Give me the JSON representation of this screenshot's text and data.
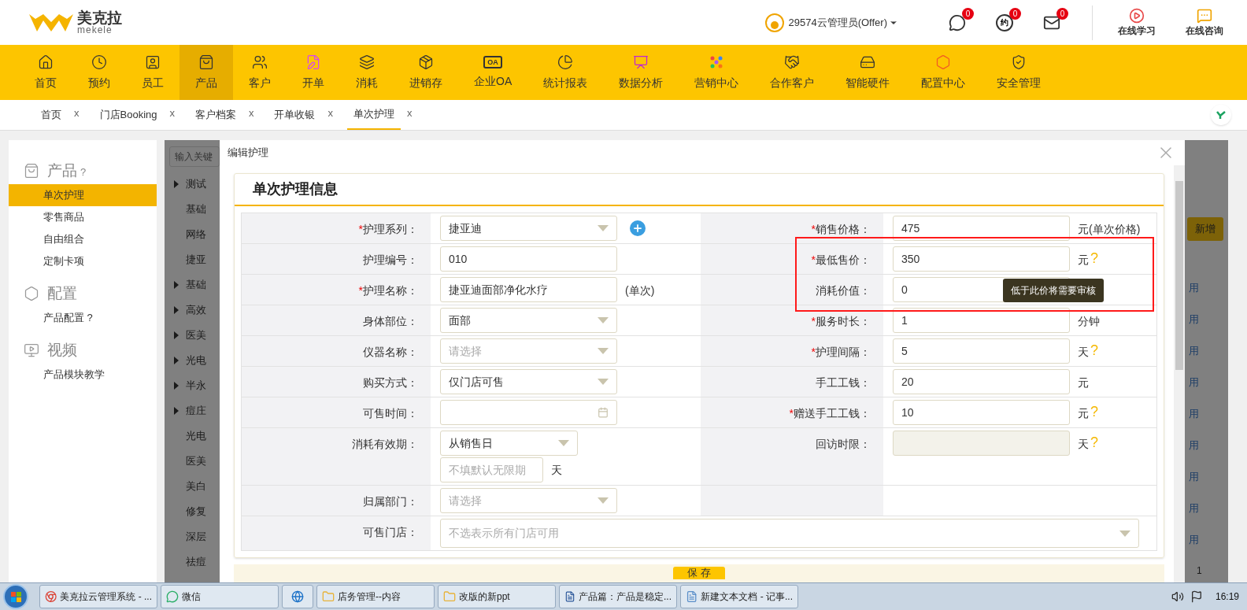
{
  "logo": {
    "name": "美克拉",
    "sub": "mekele"
  },
  "header": {
    "user": "29574云管理员(Offer)",
    "notifications": [
      {
        "badge": "0"
      },
      {
        "badge": "0",
        "glyph": "约"
      },
      {
        "badge": "0"
      }
    ],
    "links": [
      "在线学习",
      "在线咨询"
    ]
  },
  "nav": [
    {
      "label": "首页",
      "selected": false
    },
    {
      "label": "预约",
      "selected": false
    },
    {
      "label": "员工",
      "selected": false
    },
    {
      "label": "产品",
      "selected": true
    },
    {
      "label": "客户",
      "selected": false
    },
    {
      "label": "开单",
      "selected": false
    },
    {
      "label": "消耗",
      "selected": false
    },
    {
      "label": "进销存",
      "selected": false
    },
    {
      "label": "企业OA",
      "selected": false,
      "glyph": "OA"
    },
    {
      "label": "统计报表",
      "selected": false
    },
    {
      "label": "数据分析",
      "selected": false
    },
    {
      "label": "营销中心",
      "selected": false
    },
    {
      "label": "合作客户",
      "selected": false
    },
    {
      "label": "智能硬件",
      "selected": false
    },
    {
      "label": "配置中心",
      "selected": false
    },
    {
      "label": "安全管理",
      "selected": false
    }
  ],
  "tabs": [
    {
      "label": "首页",
      "close": "x",
      "selected": false
    },
    {
      "label": "门店Booking",
      "close": "x",
      "selected": false
    },
    {
      "label": "客户档案",
      "close": "x",
      "selected": false
    },
    {
      "label": "开单收银",
      "close": "x",
      "selected": false
    },
    {
      "label": "单次护理",
      "close": "x",
      "selected": true
    }
  ],
  "sidebar": [
    {
      "title": "产品",
      "help": "?",
      "items": [
        {
          "label": "单次护理",
          "selected": true
        },
        {
          "label": "零售商品",
          "selected": false
        },
        {
          "label": "自由组合",
          "selected": false
        },
        {
          "label": "定制卡项",
          "selected": false
        }
      ]
    },
    {
      "title": "配置",
      "items": [
        {
          "label": "产品配置 ?",
          "selected": false
        }
      ]
    },
    {
      "title": "视频",
      "items": [
        {
          "label": "产品模块教学",
          "selected": false
        }
      ]
    }
  ],
  "background": {
    "search_placeholder": "输入关键",
    "tree": [
      {
        "label": "测试",
        "expandable": true
      },
      {
        "label": "基础",
        "expandable": false
      },
      {
        "label": "网络",
        "expandable": false
      },
      {
        "label": "捷亚",
        "expandable": false
      },
      {
        "label": "基础",
        "expandable": true
      },
      {
        "label": "高效",
        "expandable": true
      },
      {
        "label": "医美",
        "expandable": true
      },
      {
        "label": "光电",
        "expandable": true
      },
      {
        "label": "半永",
        "expandable": true
      },
      {
        "label": "痘庄",
        "expandable": true
      },
      {
        "label": "光电",
        "expandable": false
      },
      {
        "label": "医美",
        "expandable": false
      },
      {
        "label": "美白",
        "expandable": false
      },
      {
        "label": "修复",
        "expandable": false
      },
      {
        "label": "深层",
        "expandable": false
      },
      {
        "label": "祛痘",
        "expandable": false
      }
    ],
    "add_button": "新增",
    "status_cells": [
      "用",
      "用",
      "用",
      "用",
      "用",
      "用",
      "用",
      "用",
      "用"
    ],
    "page": "1"
  },
  "modal": {
    "title": "编辑护理",
    "section": "单次护理信息",
    "save": "保 存",
    "rows": [
      {
        "left": {
          "mark": "*",
          "label": "护理系列：",
          "field": {
            "kind": "select",
            "value": "捷亚迪"
          },
          "add": true
        },
        "right": {
          "mark": "*",
          "label": "销售价格：",
          "field": {
            "kind": "input",
            "value": "475"
          },
          "suffix": "元(单次价格)"
        }
      },
      {
        "left": {
          "label": "护理编号：",
          "field": {
            "kind": "input",
            "value": "010"
          }
        },
        "right": {
          "mark": "*",
          "label": "最低售价：",
          "field": {
            "kind": "input",
            "value": "350"
          },
          "suffix": "元",
          "help": "?",
          "tooltip": "低于此价将需要审核"
        }
      },
      {
        "left": {
          "mark": "*",
          "label": "护理名称：",
          "field": {
            "kind": "input",
            "value": "捷亚迪面部净化水疗"
          },
          "suffix": "(单次)"
        },
        "right": {
          "label": "消耗价值：",
          "field": {
            "kind": "input",
            "value": "0"
          }
        }
      },
      {
        "left": {
          "label": "身体部位：",
          "field": {
            "kind": "select",
            "value": "面部"
          }
        },
        "right": {
          "mark": "*",
          "label": "服务时长：",
          "field": {
            "kind": "input",
            "value": "1"
          },
          "suffix": "分钟"
        }
      },
      {
        "left": {
          "label": "仪器名称：",
          "field": {
            "kind": "select",
            "placeholder": "请选择"
          }
        },
        "right": {
          "mark": "*",
          "label": "护理间隔：",
          "field": {
            "kind": "input",
            "value": "5"
          },
          "suffix": "天",
          "help": "?"
        }
      },
      {
        "left": {
          "label": "购买方式：",
          "field": {
            "kind": "select",
            "value": "仅门店可售"
          }
        },
        "right": {
          "label": "手工工钱：",
          "field": {
            "kind": "input",
            "value": "20"
          },
          "suffix": "元"
        }
      },
      {
        "left": {
          "label": "可售时间：",
          "field": {
            "kind": "date"
          }
        },
        "right": {
          "mark": "*",
          "label": "赠送手工工钱：",
          "field": {
            "kind": "input",
            "value": "10"
          },
          "suffix": "元",
          "help": "?"
        }
      },
      {
        "left": {
          "label": "消耗有效期：",
          "field": {
            "kind": "validity",
            "value": "从销售日",
            "placeholder": "不填默认无限期",
            "unit": "天"
          }
        },
        "right": {
          "label": "回访时限：",
          "field": {
            "kind": "input",
            "disabled": true
          },
          "suffix": "天",
          "help": "?"
        }
      },
      {
        "left": {
          "label": "归属部门：",
          "field": {
            "kind": "select",
            "placeholder": "请选择"
          }
        }
      },
      {
        "left": {
          "label": "可售门店：",
          "field": {
            "kind": "multiselect",
            "placeholder": "不选表示所有门店可用"
          }
        }
      }
    ]
  },
  "taskbar": {
    "items": [
      {
        "kind": "app",
        "label": "美克拉云管理系统 - ..."
      },
      {
        "kind": "app",
        "label": "微信"
      },
      {
        "kind": "icon"
      },
      {
        "kind": "app",
        "label": "店务管理--内容"
      },
      {
        "kind": "app",
        "label": "改版的新ppt"
      },
      {
        "kind": "app",
        "label": "产品篇：产品是稳定..."
      },
      {
        "kind": "app",
        "label": "新建文本文档 - 记事..."
      }
    ],
    "clock": "16:19"
  }
}
